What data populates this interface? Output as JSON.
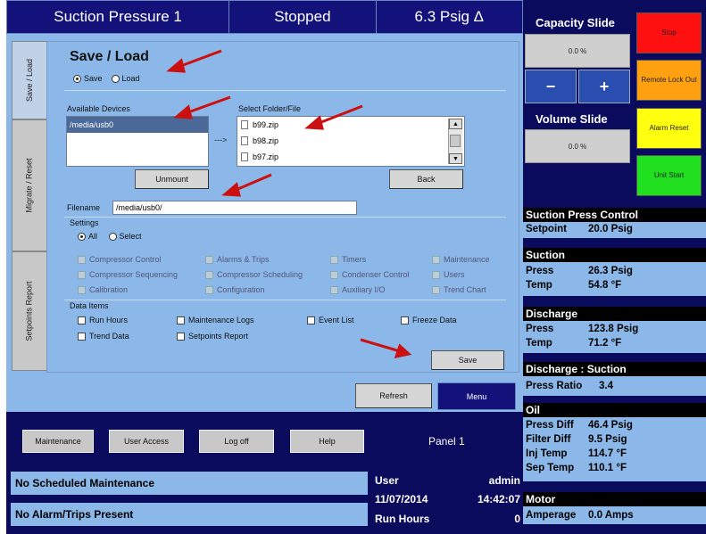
{
  "header": {
    "title": "Suction Pressure 1",
    "state": "Stopped",
    "pressure": "6.3 Psig Δ"
  },
  "tabs": [
    {
      "label": "Save / Load",
      "active": true
    },
    {
      "label": "Migrate / Reset",
      "active": false
    },
    {
      "label": "Setpoints Report",
      "active": false
    }
  ],
  "save_load": {
    "title": "Save / Load",
    "mode_options": [
      "Save",
      "Load"
    ],
    "mode_selected": "Save",
    "available_devices_label": "Available Devices",
    "devices": [
      "/media/usb0"
    ],
    "arrow_text": "--->",
    "select_folder_label": "Select Folder/File",
    "files": [
      "b99.zip",
      "b98.zip",
      "b97.zip"
    ],
    "unmount_label": "Unmount",
    "back_label": "Back",
    "filename_label": "Filename",
    "filename_value": "/media/usb0/",
    "settings_label": "Settings",
    "settings_options": [
      "All",
      "Select"
    ],
    "settings_selected": "All",
    "settings_items": [
      "Compressor Control",
      "Alarms & Trips",
      "Timers",
      "Maintenance",
      "Compressor Sequencing",
      "Compressor Scheduling",
      "Condenser Control",
      "Users",
      "Calibration",
      "Configuration",
      "Auxiliary I/O",
      "Trend Chart"
    ],
    "data_items_label": "Data Items",
    "data_items": [
      "Run Hours",
      "Maintenance Logs",
      "Event List",
      "Freeze Data",
      "Trend Data",
      "Setpoints Report"
    ],
    "save_label": "Save",
    "refresh_label": "Refresh",
    "menu_label": "Menu"
  },
  "capacity": {
    "title": "Capacity Slide",
    "value": "0.0 %",
    "minus": "−",
    "plus": "+"
  },
  "volume": {
    "title": "Volume Slide",
    "value": "0.0 %"
  },
  "side_buttons": {
    "stop": "Stop",
    "remote_lock_out": "Remote Lock Out",
    "alarm_reset": "Alarm Reset",
    "unit_start": "Unit Start"
  },
  "sections": {
    "suction_press_control": {
      "title": "Suction Press Control",
      "setpoint_label": "Setpoint",
      "setpoint_value": "20.0 Psig"
    },
    "suction": {
      "title": "Suction",
      "press_label": "Press",
      "press_value": "26.3 Psig",
      "temp_label": "Temp",
      "temp_value": "54.8 °F"
    },
    "discharge": {
      "title": "Discharge",
      "press_label": "Press",
      "press_value": "123.8 Psig",
      "temp_label": "Temp",
      "temp_value": "71.2 °F"
    },
    "discharge_suction": {
      "title": "Discharge : Suction",
      "ratio_label": "Press Ratio",
      "ratio_value": "3.4"
    },
    "oil": {
      "title": "Oil",
      "rows": [
        {
          "label": "Press Diff",
          "value": "46.4 Psig"
        },
        {
          "label": "Filter Diff",
          "value": "9.5 Psig"
        },
        {
          "label": "Inj Temp",
          "value": "114.7 °F"
        },
        {
          "label": "Sep Temp",
          "value": "110.1 °F"
        }
      ]
    },
    "motor": {
      "title": "Motor",
      "amp_label": "Amperage",
      "amp_value": "0.0 Amps"
    }
  },
  "bottom": {
    "buttons": [
      "Maintenance",
      "User Access",
      "Log off",
      "Help"
    ],
    "panel": "Panel 1",
    "maintenance_status": "No Scheduled Maintenance",
    "alarm_status": "No Alarm/Trips Present",
    "user_label": "User",
    "user_value": "admin",
    "date": "11/07/2014",
    "time": "14:42:07",
    "run_hours_label": "Run Hours",
    "run_hours_value": "0"
  }
}
